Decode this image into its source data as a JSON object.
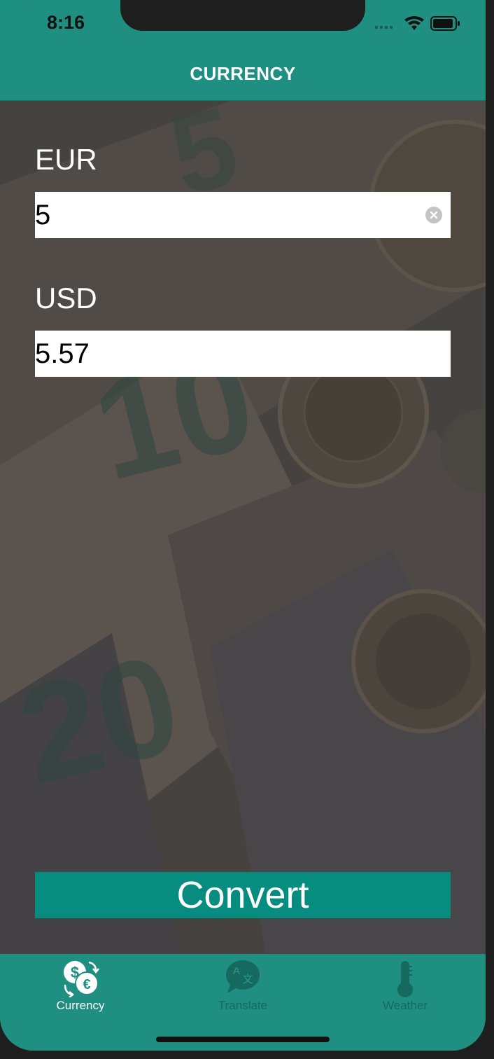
{
  "status_bar": {
    "time": "8:16"
  },
  "nav": {
    "title": "CURRENCY"
  },
  "form": {
    "from_label": "EUR",
    "from_value": "5",
    "to_label": "USD",
    "to_value": "5.57",
    "convert_label": "Convert"
  },
  "tabs": [
    {
      "label": "Currency",
      "icon": "currency-exchange-icon",
      "selected": true
    },
    {
      "label": "Translate",
      "icon": "translate-bubble-icon",
      "selected": false
    },
    {
      "label": "Weather",
      "icon": "thermometer-icon",
      "selected": false
    }
  ],
  "colors": {
    "brand_teal": "#1e8f81",
    "button_teal": "#068d7f",
    "tab_selected": "#ffffff",
    "tab_unselected": "#16695f"
  }
}
